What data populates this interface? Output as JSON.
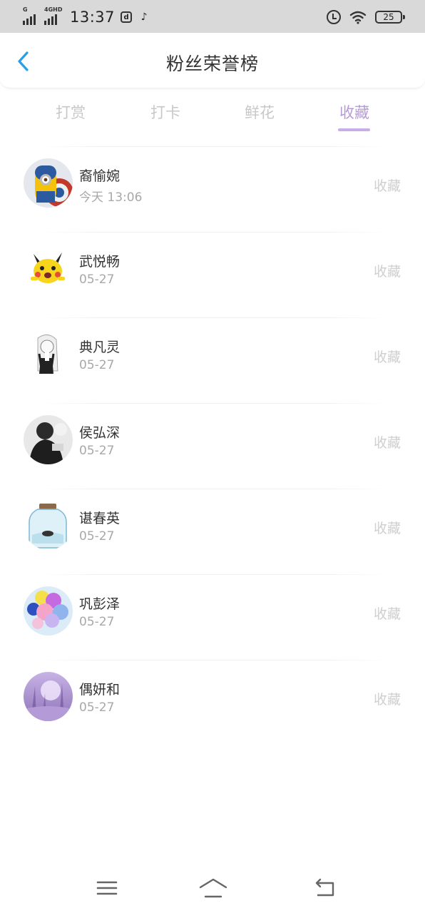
{
  "status_bar": {
    "signal1_label": "G",
    "signal2_label": "4GHD",
    "time": "13:37",
    "battery": "25",
    "icons": [
      "signal-icon",
      "signal-4g-icon",
      "app-icon",
      "tiktok-icon",
      "alarm-icon",
      "wifi-icon",
      "battery-icon"
    ]
  },
  "header": {
    "back_icon": "chevron-left-icon",
    "title": "粉丝荣誉榜"
  },
  "tabs": [
    {
      "label": "打赏",
      "active": false
    },
    {
      "label": "打卡",
      "active": false
    },
    {
      "label": "鲜花",
      "active": false
    },
    {
      "label": "收藏",
      "active": true
    }
  ],
  "list": [
    {
      "name": "裔愉婉",
      "date": "今天 13:06",
      "action": "收藏",
      "avatar": "minion-captain-avatar"
    },
    {
      "name": "武悦畅",
      "date": "05-27",
      "action": "收藏",
      "avatar": "pikachu-avatar"
    },
    {
      "name": "典凡灵",
      "date": "05-27",
      "action": "收藏",
      "avatar": "sketch-girl-avatar"
    },
    {
      "name": "侯弘深",
      "date": "05-27",
      "action": "收藏",
      "avatar": "dark-portrait-avatar"
    },
    {
      "name": "谌春英",
      "date": "05-27",
      "action": "收藏",
      "avatar": "glass-jar-avatar"
    },
    {
      "name": "巩彭泽",
      "date": "05-27",
      "action": "收藏",
      "avatar": "balloons-avatar"
    },
    {
      "name": "偶妍和",
      "date": "05-27",
      "action": "收藏",
      "avatar": "purple-forest-avatar"
    }
  ],
  "nav_bar": {
    "icons": [
      "menu-icon",
      "home-icon",
      "back-icon"
    ]
  },
  "colors": {
    "accent": "#b79ad8",
    "tab_indicator": "#c9ade8",
    "back_arrow": "#2a9ee6",
    "status_bar_bg": "#d9d9d9"
  }
}
